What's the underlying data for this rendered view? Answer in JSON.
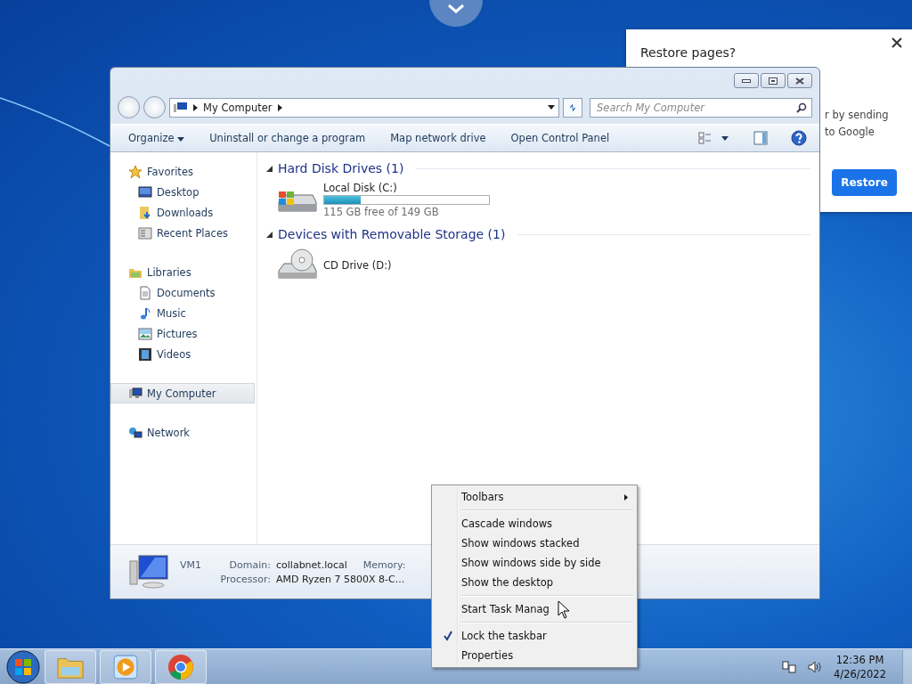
{
  "restore_popup": {
    "title": "Restore pages?",
    "text_lines": [
      "r by sending",
      "to Google"
    ],
    "button": "Restore"
  },
  "explorer": {
    "address": "My Computer",
    "search": {
      "placeholder": "Search My Computer"
    },
    "toolbar": [
      {
        "label": "Organize",
        "dropdown": true
      },
      {
        "label": "Uninstall or change a program",
        "dropdown": false
      },
      {
        "label": "Map network drive",
        "dropdown": false
      },
      {
        "label": "Open Control Panel",
        "dropdown": false
      }
    ],
    "sidebar": [
      {
        "label": "Favorites",
        "kind": "star",
        "selected": false,
        "children": [
          {
            "label": "Desktop",
            "kind": "desktop",
            "selected": false
          },
          {
            "label": "Downloads",
            "kind": "downloads",
            "selected": false
          },
          {
            "label": "Recent Places",
            "kind": "recent",
            "selected": false
          }
        ]
      },
      {
        "label": "Libraries",
        "kind": "library",
        "selected": false,
        "children": [
          {
            "label": "Documents",
            "kind": "document",
            "selected": false
          },
          {
            "label": "Music",
            "kind": "music",
            "selected": false
          },
          {
            "label": "Pictures",
            "kind": "picture",
            "selected": false
          },
          {
            "label": "Videos",
            "kind": "video",
            "selected": false
          }
        ]
      },
      {
        "label": "My Computer",
        "kind": "computer",
        "selected": true
      },
      {
        "label": "Network",
        "kind": "network",
        "selected": false
      }
    ],
    "sections": [
      {
        "title": "Hard Disk Drives (1)",
        "expanded": true,
        "items": [
          {
            "name": "Local Disk (C:)",
            "kind": "disk",
            "level": 0.22,
            "detail": "115 GB free of 149 GB"
          }
        ]
      },
      {
        "title": "Devices with Removable Storage (1)",
        "expanded": true,
        "items": [
          {
            "name": "CD Drive (D:)",
            "kind": "cd"
          }
        ]
      }
    ],
    "details": {
      "name": "VM1",
      "fields": [
        {
          "label": "Domain:",
          "value": "collabnet.local"
        },
        {
          "label": "Memory:"
        },
        {
          "label": "Processor:",
          "value": "AMD Ryzen 7 5800X 8-C..."
        }
      ]
    }
  },
  "context_menu": [
    {
      "kind": "submenu",
      "label": "Toolbars",
      "checked": false
    },
    {
      "kind": "separator"
    },
    {
      "kind": "item",
      "label": "Cascade windows",
      "checked": false
    },
    {
      "kind": "item",
      "label": "Show windows stacked",
      "checked": false
    },
    {
      "kind": "item",
      "label": "Show windows side by side",
      "checked": false
    },
    {
      "kind": "item",
      "label": "Show the desktop",
      "checked": false
    },
    {
      "kind": "separator"
    },
    {
      "kind": "item",
      "label": "Start Task Manag",
      "checked": false
    },
    {
      "kind": "separator"
    },
    {
      "kind": "item",
      "label": "Lock the taskbar",
      "checked": true
    },
    {
      "kind": "item",
      "label": "Properties",
      "checked": false
    }
  ],
  "taskbar": {
    "clock_time": "12:36 PM",
    "clock_date": "4/26/2022"
  }
}
